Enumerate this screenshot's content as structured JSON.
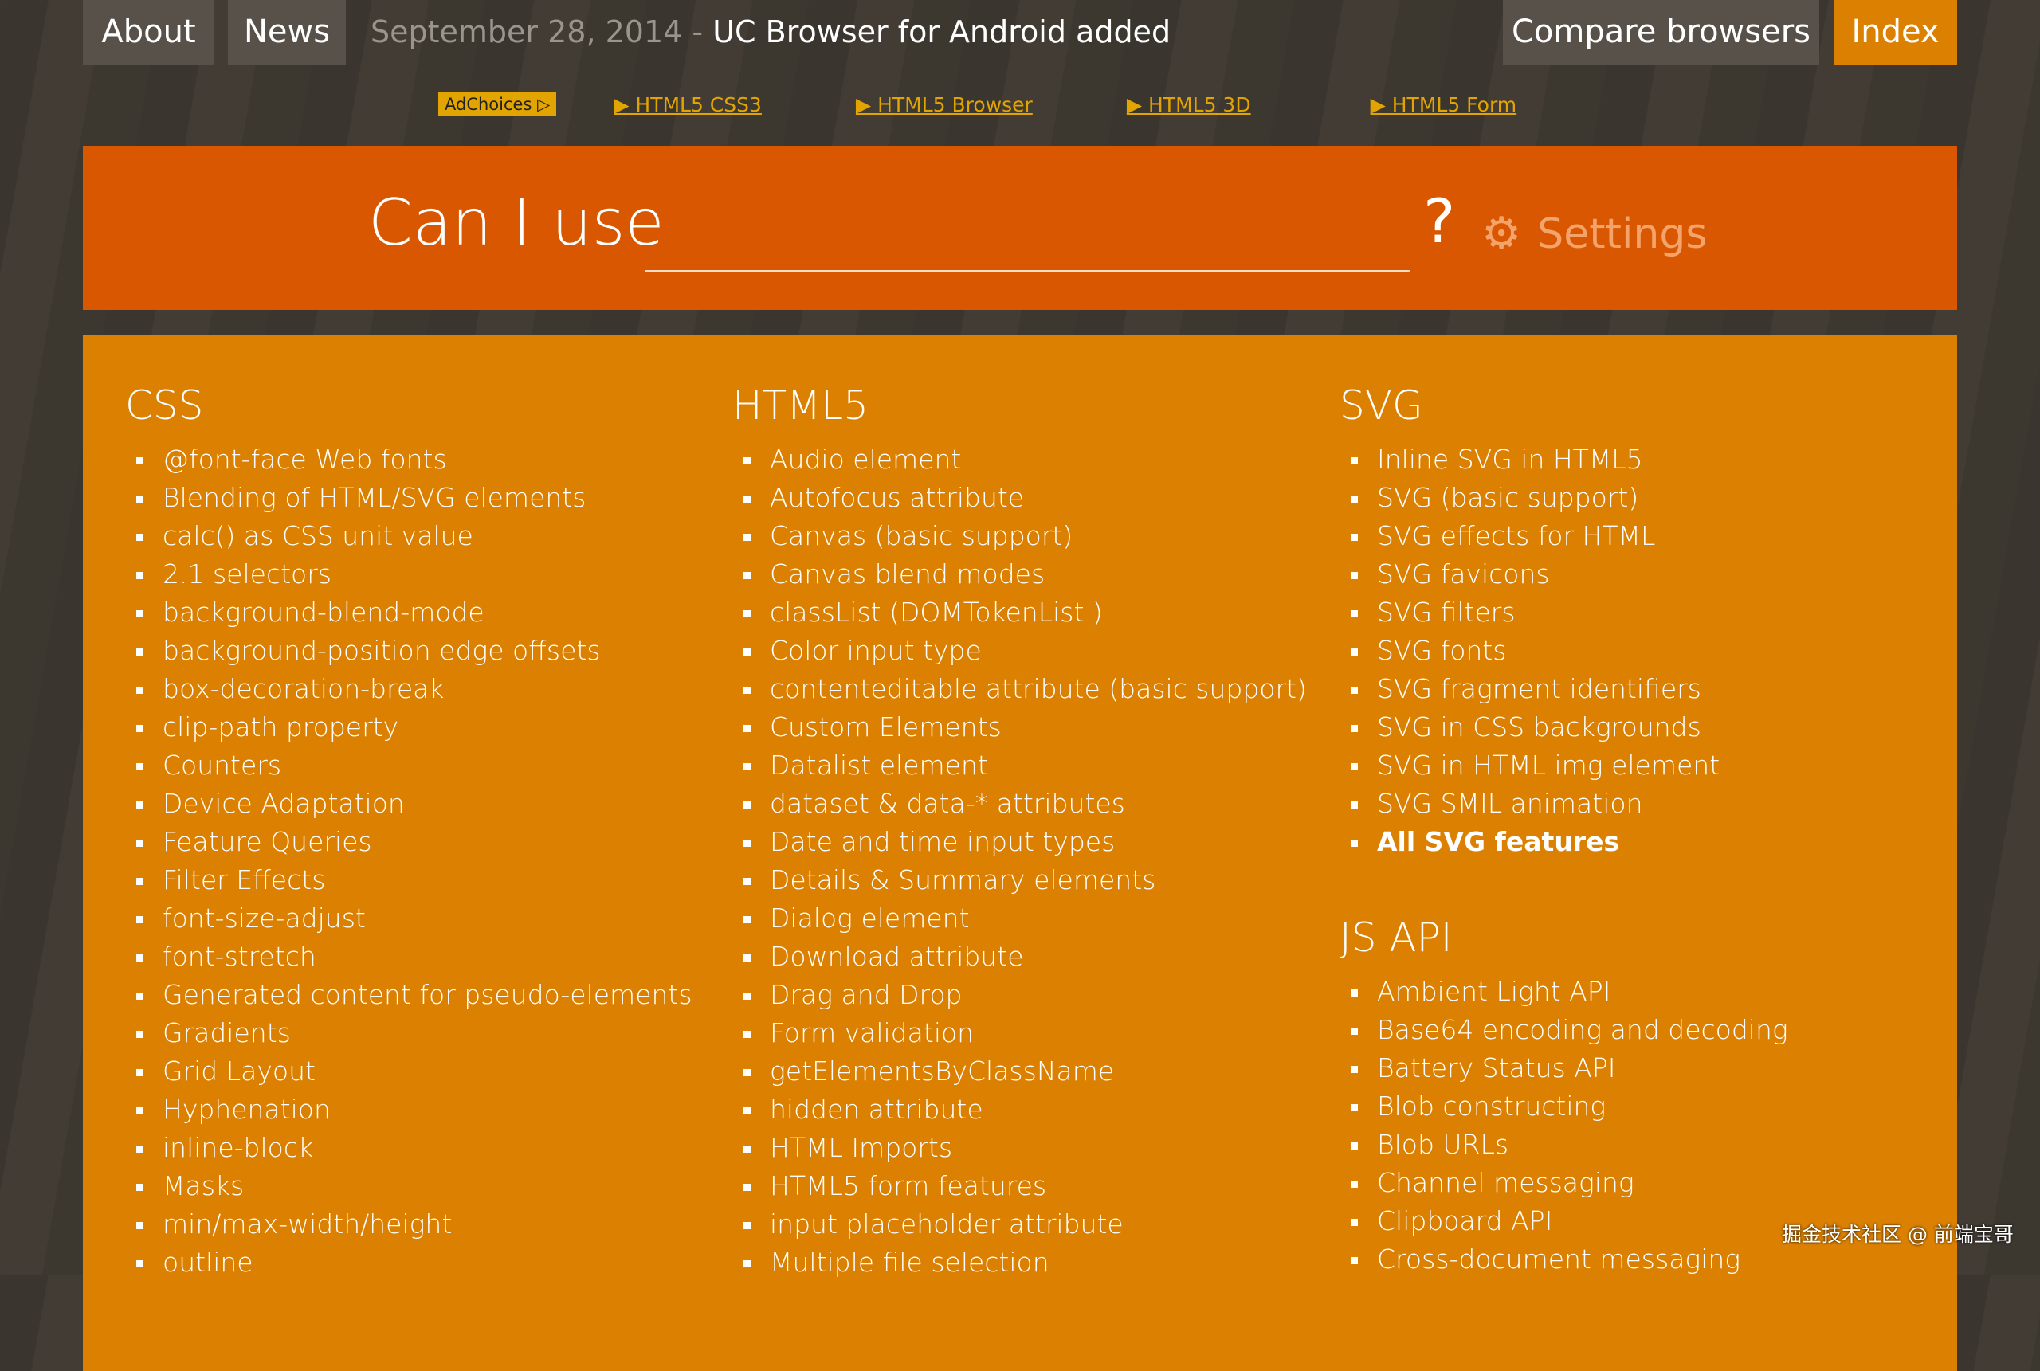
{
  "nav": {
    "about": "About",
    "news": "News",
    "news_date": "September 28, 2014 - ",
    "news_text": "UC Browser for Android added",
    "compare": "Compare browsers",
    "index": "Index"
  },
  "ads": {
    "adchoices": "AdChoices ▷",
    "links": [
      "▶ HTML5 CSS3",
      "▶ HTML5 Browser",
      "▶ HTML5 3D",
      "▶ HTML5 Form"
    ]
  },
  "header": {
    "title": "Can I use",
    "search_value": "",
    "question": "?",
    "settings": "Settings"
  },
  "sections": {
    "css": {
      "title": "CSS",
      "items": [
        "@font-face Web fonts",
        "Blending of HTML/SVG elements",
        "calc() as CSS unit value",
        "2.1 selectors",
        "background-blend-mode",
        "background-position edge offsets",
        "box-decoration-break",
        "clip-path property",
        "Counters",
        "Device Adaptation",
        "Feature Queries",
        "Filter Effects",
        "font-size-adjust",
        "font-stretch",
        "Generated content for pseudo-elements",
        "Gradients",
        "Grid Layout",
        "Hyphenation",
        "inline-block",
        "Masks",
        "min/max-width/height",
        "outline"
      ]
    },
    "html5": {
      "title": "HTML5",
      "items": [
        "Audio element",
        "Autofocus attribute",
        "Canvas (basic support)",
        "Canvas blend modes",
        "classList (DOMTokenList )",
        "Color input type",
        "contenteditable attribute (basic support)",
        "Custom Elements",
        "Datalist element",
        "dataset & data-* attributes",
        "Date and time input types",
        "Details & Summary elements",
        "Dialog element",
        "Download attribute",
        "Drag and Drop",
        "Form validation",
        "getElementsByClassName",
        "hidden attribute",
        "HTML Imports",
        "HTML5 form features",
        "input placeholder attribute",
        "Multiple file selection"
      ]
    },
    "svg": {
      "title": "SVG",
      "items": [
        "Inline SVG in HTML5",
        "SVG (basic support)",
        "SVG effects for HTML",
        "SVG favicons",
        "SVG filters",
        "SVG fonts",
        "SVG fragment identifiers",
        "SVG in CSS backgrounds",
        "SVG in HTML img element",
        "SVG SMIL animation"
      ],
      "all": "All SVG features"
    },
    "jsapi": {
      "title": "JS API",
      "items": [
        "Ambient Light API",
        "Base64 encoding and decoding",
        "Battery Status API",
        "Blob constructing",
        "Blob URLs",
        "Channel messaging",
        "Clipboard API",
        "Cross-document messaging"
      ]
    }
  },
  "watermark": "掘金技术社区 @ 前端宝哥",
  "colors": {
    "header": "#d95700",
    "panel": "#db8000",
    "index_tab": "#db8000"
  }
}
